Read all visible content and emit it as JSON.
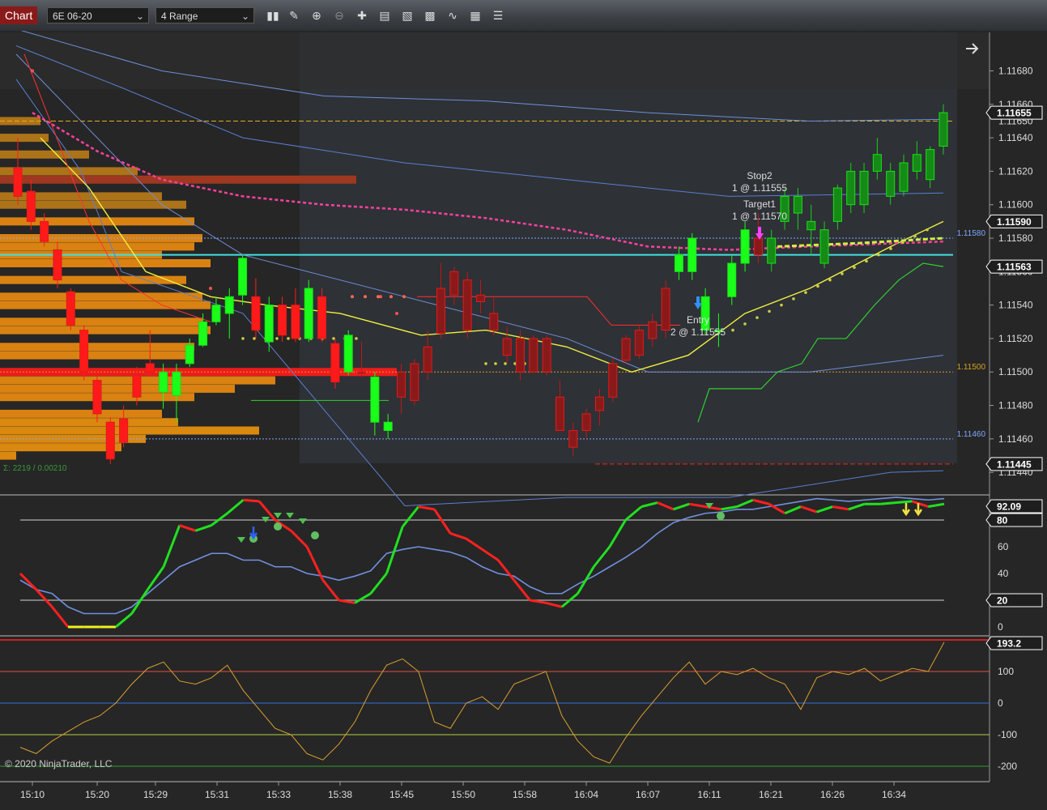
{
  "toolbar": {
    "chart_label": "Chart",
    "instrument": "6E 06-20",
    "bar_type": "4 Range"
  },
  "icons": [
    "bar-style-icon",
    "draw-pencil-icon",
    "zoom-in-icon",
    "zoom-out-icon",
    "crosshair-icon",
    "properties-icon",
    "data-box-icon",
    "strategies-icon",
    "indicators-icon",
    "templates-icon",
    "more-icon"
  ],
  "price_panel": {
    "ticks": [
      "1.11680",
      "1.11660",
      "1.11640",
      "1.11620",
      "1.11600",
      "1.11580",
      "1.11560",
      "1.11540",
      "1.11520",
      "1.11500",
      "1.11480",
      "1.11460",
      "1.11440"
    ],
    "tick_values": [
      1.1168,
      1.1166,
      1.1164,
      1.1162,
      1.116,
      1.1158,
      1.1156,
      1.1154,
      1.1152,
      1.115,
      1.1148,
      1.1146,
      1.1144
    ],
    "ylim": [
      1.11427,
      1.11703
    ],
    "markers": [
      {
        "label": "1.11655",
        "value": 1.11655,
        "color": "#ffffff"
      },
      {
        "label": "1.11590",
        "value": 1.1159,
        "color": "#ffffff"
      },
      {
        "label": "1.11563",
        "value": 1.11563,
        "color": "#ffffff"
      },
      {
        "label": "1.11445",
        "value": 1.11445,
        "color": "#ffffff"
      }
    ],
    "hidden_tick": "1.11650",
    "level_labels": [
      {
        "label": "1.11580",
        "value": 1.1158,
        "color": "#7fa8ff"
      },
      {
        "label": "1.11500",
        "value": 1.115,
        "color": "#d8a020"
      },
      {
        "label": "1.11460",
        "value": 1.1146,
        "color": "#7fa8ff"
      }
    ],
    "annotations": {
      "stop_title": "Stop2",
      "stop_detail": "1 @ 1.11555",
      "target_title": "Target1",
      "target_detail": "1 @ 1.11570",
      "entry_title": "Entry",
      "entry_detail": "2 @ 1.11555"
    },
    "volume_profile_text": "Σ: 2219 / 0.00210"
  },
  "oscillator_panel": {
    "ticks": [
      "80",
      "60",
      "40",
      "20",
      "0"
    ],
    "tick_values": [
      80,
      60,
      40,
      20,
      0
    ],
    "markers": [
      {
        "label": "92.09",
        "value": 92.09
      },
      {
        "label": "80",
        "value": 80
      },
      {
        "label": "20",
        "value": 20
      }
    ]
  },
  "cci_panel": {
    "ticks": [
      "100",
      "0",
      "-100",
      "-200"
    ],
    "tick_values": [
      100,
      0,
      -100,
      -200
    ],
    "marker": {
      "label": "193.2",
      "value": 193.2
    }
  },
  "time_axis": [
    "15:10",
    "15:20",
    "15:29",
    "15:31",
    "15:33",
    "15:38",
    "15:45",
    "15:50",
    "15:58",
    "16:04",
    "16:07",
    "16:11",
    "16:21",
    "16:26",
    "16:34"
  ],
  "copyright": "© 2020 NinjaTrader, LLC",
  "chart_data": {
    "type": "candlestick",
    "instrument": "6E 06-20",
    "bar_type": "4 Range",
    "y_range": [
      1.11427,
      1.11703
    ],
    "bars": [
      {
        "o": 1.11622,
        "h": 1.1164,
        "l": 1.116,
        "c": 1.11605,
        "dir": "down"
      },
      {
        "o": 1.11608,
        "h": 1.11615,
        "l": 1.11585,
        "c": 1.1159,
        "dir": "down"
      },
      {
        "o": 1.1159,
        "h": 1.11595,
        "l": 1.11575,
        "c": 1.11578,
        "dir": "down"
      },
      {
        "o": 1.11573,
        "h": 1.11578,
        "l": 1.1155,
        "c": 1.11555,
        "dir": "down"
      },
      {
        "o": 1.11548,
        "h": 1.1155,
        "l": 1.11525,
        "c": 1.11528,
        "dir": "down"
      },
      {
        "o": 1.11525,
        "h": 1.11528,
        "l": 1.11495,
        "c": 1.115,
        "dir": "down"
      },
      {
        "o": 1.11495,
        "h": 1.115,
        "l": 1.1147,
        "c": 1.11475,
        "dir": "down"
      },
      {
        "o": 1.1147,
        "h": 1.11473,
        "l": 1.11445,
        "c": 1.11448,
        "dir": "down"
      },
      {
        "o": 1.11472,
        "h": 1.1148,
        "l": 1.11455,
        "c": 1.11458,
        "dir": "down"
      },
      {
        "o": 1.11498,
        "h": 1.11503,
        "l": 1.1148,
        "c": 1.11485,
        "dir": "down"
      },
      {
        "o": 1.115,
        "h": 1.11525,
        "l": 1.11498,
        "c": 1.11505,
        "dir": "down"
      },
      {
        "o": 1.11488,
        "h": 1.11505,
        "l": 1.11478,
        "c": 1.115,
        "dir": "up"
      },
      {
        "o": 1.11486,
        "h": 1.11505,
        "l": 1.1147,
        "c": 1.115,
        "dir": "up"
      },
      {
        "o": 1.11505,
        "h": 1.1152,
        "l": 1.11503,
        "c": 1.11516,
        "dir": "up"
      },
      {
        "o": 1.11516,
        "h": 1.11535,
        "l": 1.11515,
        "c": 1.1153,
        "dir": "up"
      },
      {
        "o": 1.1153,
        "h": 1.11545,
        "l": 1.11528,
        "c": 1.1154,
        "dir": "up"
      },
      {
        "o": 1.11535,
        "h": 1.1155,
        "l": 1.1152,
        "c": 1.11545,
        "dir": "up"
      },
      {
        "o": 1.11546,
        "h": 1.1157,
        "l": 1.1154,
        "c": 1.11568,
        "dir": "up"
      },
      {
        "o": 1.11545,
        "h": 1.11556,
        "l": 1.1152,
        "c": 1.11525,
        "dir": "down"
      },
      {
        "o": 1.11518,
        "h": 1.11545,
        "l": 1.11512,
        "c": 1.1154,
        "dir": "up"
      },
      {
        "o": 1.1154,
        "h": 1.11545,
        "l": 1.11518,
        "c": 1.11522,
        "dir": "down"
      },
      {
        "o": 1.1154,
        "h": 1.1155,
        "l": 1.11518,
        "c": 1.1152,
        "dir": "down"
      },
      {
        "o": 1.1152,
        "h": 1.11555,
        "l": 1.11518,
        "c": 1.1155,
        "dir": "up"
      },
      {
        "o": 1.11545,
        "h": 1.1155,
        "l": 1.11518,
        "c": 1.1152,
        "dir": "down"
      },
      {
        "o": 1.11517,
        "h": 1.1152,
        "l": 1.1149,
        "c": 1.11494,
        "dir": "down"
      },
      {
        "o": 1.115,
        "h": 1.11525,
        "l": 1.11498,
        "c": 1.11522,
        "dir": "up"
      },
      {
        "o": 1.115,
        "h": 1.11518,
        "l": 1.11497,
        "c": 1.115,
        "dir": "down"
      },
      {
        "o": 1.11497,
        "h": 1.115,
        "l": 1.11462,
        "c": 1.1147,
        "dir": "up"
      },
      {
        "o": 1.1147,
        "h": 1.11475,
        "l": 1.1146,
        "c": 1.11465,
        "dir": "up"
      },
      {
        "o": 1.115,
        "h": 1.11505,
        "l": 1.11475,
        "c": 1.11485,
        "dir": "down"
      },
      {
        "o": 1.11505,
        "h": 1.11508,
        "l": 1.1148,
        "c": 1.11483,
        "dir": "down"
      },
      {
        "o": 1.11515,
        "h": 1.11525,
        "l": 1.11495,
        "c": 1.115,
        "dir": "down"
      },
      {
        "o": 1.1155,
        "h": 1.11565,
        "l": 1.1152,
        "c": 1.11523,
        "dir": "down"
      },
      {
        "o": 1.1156,
        "h": 1.11563,
        "l": 1.1154,
        "c": 1.11546,
        "dir": "down"
      },
      {
        "o": 1.11525,
        "h": 1.1156,
        "l": 1.1152,
        "c": 1.11555,
        "dir": "down"
      },
      {
        "o": 1.11546,
        "h": 1.11555,
        "l": 1.11535,
        "c": 1.11542,
        "dir": "down"
      },
      {
        "o": 1.11525,
        "h": 1.11545,
        "l": 1.11522,
        "c": 1.11535,
        "dir": "down"
      },
      {
        "o": 1.1152,
        "h": 1.11527,
        "l": 1.11505,
        "c": 1.1151,
        "dir": "down"
      },
      {
        "o": 1.1152,
        "h": 1.11525,
        "l": 1.11495,
        "c": 1.115,
        "dir": "down"
      },
      {
        "o": 1.1152,
        "h": 1.11522,
        "l": 1.115,
        "c": 1.115,
        "dir": "down"
      },
      {
        "o": 1.1152,
        "h": 1.11522,
        "l": 1.11498,
        "c": 1.115,
        "dir": "down"
      },
      {
        "o": 1.11485,
        "h": 1.11495,
        "l": 1.11465,
        "c": 1.11465,
        "dir": "down"
      },
      {
        "o": 1.11465,
        "h": 1.1147,
        "l": 1.1145,
        "c": 1.11455,
        "dir": "down"
      },
      {
        "o": 1.11475,
        "h": 1.11478,
        "l": 1.1146,
        "c": 1.11465,
        "dir": "down"
      },
      {
        "o": 1.11485,
        "h": 1.1149,
        "l": 1.11468,
        "c": 1.11477,
        "dir": "down"
      },
      {
        "o": 1.11505,
        "h": 1.11508,
        "l": 1.11482,
        "c": 1.11485,
        "dir": "down"
      },
      {
        "o": 1.1152,
        "h": 1.11522,
        "l": 1.11505,
        "c": 1.11507,
        "dir": "down"
      },
      {
        "o": 1.11525,
        "h": 1.11528,
        "l": 1.11508,
        "c": 1.1151,
        "dir": "down"
      },
      {
        "o": 1.1153,
        "h": 1.11535,
        "l": 1.11515,
        "c": 1.1152,
        "dir": "down"
      },
      {
        "o": 1.1155,
        "h": 1.11555,
        "l": 1.1152,
        "c": 1.11525,
        "dir": "down"
      },
      {
        "o": 1.1156,
        "h": 1.11575,
        "l": 1.11555,
        "c": 1.1157,
        "dir": "up"
      },
      {
        "o": 1.1156,
        "h": 1.11583,
        "l": 1.11555,
        "c": 1.1158,
        "dir": "up"
      },
      {
        "o": 1.11525,
        "h": 1.1155,
        "l": 1.11522,
        "c": 1.11545,
        "dir": "up"
      },
      {
        "o": 1.11525,
        "h": 1.11535,
        "l": 1.11515,
        "c": 1.11525,
        "dir": "up"
      },
      {
        "o": 1.11545,
        "h": 1.1157,
        "l": 1.1154,
        "c": 1.11565,
        "dir": "up"
      },
      {
        "o": 1.11565,
        "h": 1.1159,
        "l": 1.1156,
        "c": 1.11585,
        "dir": "up"
      },
      {
        "o": 1.1157,
        "h": 1.11595,
        "l": 1.11565,
        "c": 1.1158,
        "dir": "down"
      },
      {
        "o": 1.11565,
        "h": 1.11585,
        "l": 1.1156,
        "c": 1.1158,
        "dir": "up"
      },
      {
        "o": 1.1159,
        "h": 1.1161,
        "l": 1.11585,
        "c": 1.11605,
        "dir": "up"
      },
      {
        "o": 1.11605,
        "h": 1.1161,
        "l": 1.11585,
        "c": 1.11595,
        "dir": "up"
      },
      {
        "o": 1.1159,
        "h": 1.116,
        "l": 1.1157,
        "c": 1.11585,
        "dir": "up"
      },
      {
        "o": 1.11565,
        "h": 1.1159,
        "l": 1.11562,
        "c": 1.11585,
        "dir": "up"
      },
      {
        "o": 1.1159,
        "h": 1.11612,
        "l": 1.11585,
        "c": 1.1161,
        "dir": "up"
      },
      {
        "o": 1.116,
        "h": 1.11625,
        "l": 1.11595,
        "c": 1.1162,
        "dir": "up"
      },
      {
        "o": 1.116,
        "h": 1.11625,
        "l": 1.11595,
        "c": 1.1162,
        "dir": "up"
      },
      {
        "o": 1.1162,
        "h": 1.1164,
        "l": 1.11615,
        "c": 1.1163,
        "dir": "up"
      },
      {
        "o": 1.1162,
        "h": 1.11625,
        "l": 1.116,
        "c": 1.11605,
        "dir": "up"
      },
      {
        "o": 1.11608,
        "h": 1.1163,
        "l": 1.11605,
        "c": 1.11625,
        "dir": "up"
      },
      {
        "o": 1.1162,
        "h": 1.11638,
        "l": 1.11615,
        "c": 1.1163,
        "dir": "up"
      },
      {
        "o": 1.11615,
        "h": 1.11635,
        "l": 1.1161,
        "c": 1.11633,
        "dir": "up"
      },
      {
        "o": 1.11635,
        "h": 1.1166,
        "l": 1.1163,
        "c": 1.11655,
        "dir": "up"
      }
    ],
    "levels": [
      {
        "value": 1.1165,
        "color": "#e0b020",
        "style": "dashed"
      },
      {
        "value": 1.1157,
        "color": "#40e0e0",
        "style": "solid"
      },
      {
        "value": 1.1158,
        "color": "#7fa8ff",
        "style": "dotted"
      },
      {
        "value": 1.115,
        "color": "#d8a020",
        "style": "dotted"
      },
      {
        "value": 1.1146,
        "color": "#7fa8ff",
        "style": "dotted"
      },
      {
        "value": 1.11445,
        "color": "#ff2020",
        "style": "dashed"
      }
    ],
    "volume_profile": [
      {
        "p": 1.1165,
        "len": 50
      },
      {
        "p": 1.1164,
        "len": 60
      },
      {
        "p": 1.1163,
        "len": 110
      },
      {
        "p": 1.1162,
        "len": 170
      },
      {
        "p": 1.11615,
        "len": 440,
        "poc": true
      },
      {
        "p": 1.11605,
        "len": 200
      },
      {
        "p": 1.116,
        "len": 230
      },
      {
        "p": 1.1159,
        "len": 240
      },
      {
        "p": 1.1158,
        "len": 250
      },
      {
        "p": 1.11575,
        "len": 240
      },
      {
        "p": 1.1157,
        "len": 200
      },
      {
        "p": 1.11565,
        "len": 260
      },
      {
        "p": 1.11555,
        "len": 230
      },
      {
        "p": 1.11545,
        "len": 250
      },
      {
        "p": 1.1154,
        "len": 260
      },
      {
        "p": 1.1153,
        "len": 250
      },
      {
        "p": 1.11525,
        "len": 260
      },
      {
        "p": 1.11515,
        "len": 240
      },
      {
        "p": 1.1151,
        "len": 230
      },
      {
        "p": 1.115,
        "len": 490,
        "poc": true
      },
      {
        "p": 1.11495,
        "len": 340
      },
      {
        "p": 1.1149,
        "len": 290
      },
      {
        "p": 1.11485,
        "len": 240
      },
      {
        "p": 1.11475,
        "len": 200
      },
      {
        "p": 1.1147,
        "len": 220
      },
      {
        "p": 1.11465,
        "len": 320
      },
      {
        "p": 1.1146,
        "len": 180
      },
      {
        "p": 1.11455,
        "len": 150
      },
      {
        "p": 1.1145,
        "len": 20
      }
    ],
    "oscillator": {
      "fast": [
        40,
        28,
        15,
        0,
        0,
        0,
        0,
        10,
        28,
        45,
        76,
        72,
        76,
        85,
        95,
        94,
        80,
        72,
        60,
        35,
        20,
        18,
        25,
        40,
        75,
        90,
        88,
        70,
        66,
        58,
        50,
        35,
        20,
        18,
        15,
        25,
        45,
        60,
        80,
        90,
        93,
        88,
        92,
        90,
        88,
        90,
        95,
        92,
        85,
        90,
        86,
        90,
        88,
        92,
        92,
        93,
        94,
        90,
        92
      ],
      "slow": [
        35,
        28,
        25,
        15,
        10,
        10,
        10,
        15,
        25,
        35,
        45,
        50,
        55,
        55,
        50,
        50,
        45,
        45,
        40,
        38,
        35,
        38,
        42,
        55,
        58,
        60,
        58,
        56,
        52,
        45,
        40,
        38,
        30,
        25,
        25,
        32,
        38,
        45,
        52,
        60,
        70,
        78,
        82,
        85,
        86,
        88,
        88,
        90,
        92,
        94,
        96,
        95,
        94,
        95,
        96,
        97,
        96,
        95,
        96
      ]
    },
    "cci": [
      -140,
      -160,
      -120,
      -90,
      -60,
      -40,
      0,
      60,
      110,
      130,
      70,
      60,
      80,
      120,
      40,
      -20,
      -80,
      -100,
      -160,
      -180,
      -130,
      -60,
      40,
      120,
      140,
      100,
      -60,
      -80,
      0,
      20,
      -20,
      60,
      80,
      100,
      -40,
      -120,
      -170,
      -190,
      -110,
      -40,
      20,
      80,
      130,
      60,
      100,
      90,
      110,
      80,
      60,
      -20,
      80,
      100,
      90,
      110,
      70,
      90,
      110,
      100,
      193
    ]
  }
}
